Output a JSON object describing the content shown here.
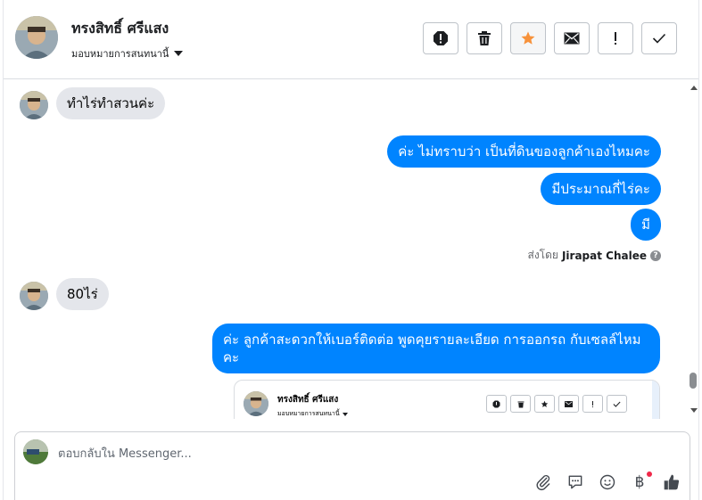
{
  "header": {
    "contact_name": "ทรงสิทธิ์ ศรีแสง",
    "assign_label": "มอบหมายการสนทนานี้",
    "toolbar": [
      {
        "name": "spam-button",
        "icon": "alert-octagon-icon"
      },
      {
        "name": "delete-button",
        "icon": "trash-icon"
      },
      {
        "name": "star-button",
        "icon": "star-icon",
        "color": "#f7923b"
      },
      {
        "name": "email-button",
        "icon": "envelope-icon"
      },
      {
        "name": "follow-up-button",
        "icon": "exclamation-icon"
      },
      {
        "name": "done-button",
        "icon": "check-icon"
      }
    ]
  },
  "messages": [
    {
      "side": "in",
      "text": "ทำไร่ทำสวนค่ะ"
    },
    {
      "side": "out",
      "text": "ค่ะ ไม่ทราบว่า เป็นที่ดินของลูกค้าเองไหมคะ"
    },
    {
      "side": "out",
      "text": "มีประมาณกี่ไร่คะ"
    },
    {
      "side": "out",
      "text": "มี"
    },
    {
      "side": "in",
      "text": "80ไร่"
    },
    {
      "side": "out",
      "text": "ค่ะ ลูกค้าสะดวกให้เบอร์ติดต่อ พูดคุยรายละเอียด การออกรถ กับเซลล์ไหม คะ"
    }
  ],
  "sent_by": {
    "prefix": "ส่งโดย",
    "agent": "Jirapat Chalee",
    "help": "?"
  },
  "embedded_card": {
    "contact_name": "ทรงสิทธิ์ ศรีแสง",
    "assign_label": "มอบหมายการสนทนานี้"
  },
  "composer": {
    "placeholder": "ตอบกลับใน Messenger...",
    "tools": [
      "paperclip-icon",
      "speech-bubble-icon",
      "smiley-icon",
      "baht-icon",
      "thumbs-up-icon"
    ],
    "baht_symbol": "฿"
  },
  "colors": {
    "outgoing": "#0084ff",
    "incoming": "#e4e6eb",
    "star": "#f7923b",
    "notification_dot": "#f02849"
  }
}
